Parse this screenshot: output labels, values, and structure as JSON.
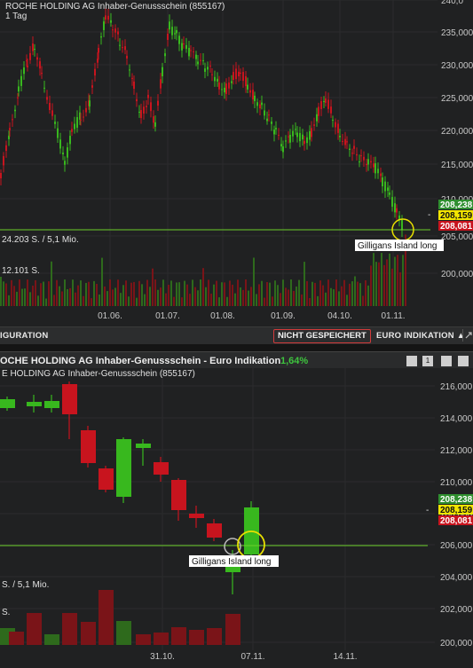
{
  "top": {
    "title": "ROCHE HOLDING AG Inhaber-Genussschein (855167)",
    "interval": "1 Tag",
    "price_axis": [
      "240,0",
      "235,000",
      "230,000",
      "225,000",
      "220,000",
      "215,000",
      "210,000",
      "205,000",
      "200,000"
    ],
    "date_axis": [
      "01.06.",
      "01.07.",
      "01.08.",
      "01.09.",
      "04.10.",
      "01.11."
    ],
    "volume_label": "24.203 S. / 5,1 Mio.",
    "volume_scale": "12.101 S.",
    "price_tags": {
      "bid": "208,238",
      "last": "208,159",
      "ask": "208,081"
    },
    "annotation": "Gilligans Island long"
  },
  "toolbar": {
    "left_label": "IGURATION",
    "not_saved": "NICHT GESPEICHERT",
    "indication": "EURO INDIKATION ▲"
  },
  "bottom": {
    "window_title": "OCHE HOLDING AG Inhaber-Genussschein - Euro Indikation",
    "change_pct": "1,64%",
    "subtitle": "E HOLDING AG Inhaber-Genussschein (855167)",
    "price_axis": [
      "216,000",
      "214,000",
      "212,000",
      "210,000",
      "208,000",
      "206,000",
      "204,000",
      "202,000",
      "200,000"
    ],
    "date_axis": [
      "31.10.",
      "07.11.",
      "14.11."
    ],
    "volume_label": "S. / 5,1 Mio.",
    "volume_scale": "S.",
    "price_tags": {
      "bid": "208,238",
      "last": "208,159",
      "ask": "208,081"
    },
    "annotation": "Gilligans Island long"
  },
  "colors": {
    "up": "#38b81e",
    "down": "#c8141e",
    "bid_tag": "#2f8f2f",
    "last_tag": "#f2e500",
    "ask_tag": "#c8141e",
    "hline": "#6bd02a"
  }
}
